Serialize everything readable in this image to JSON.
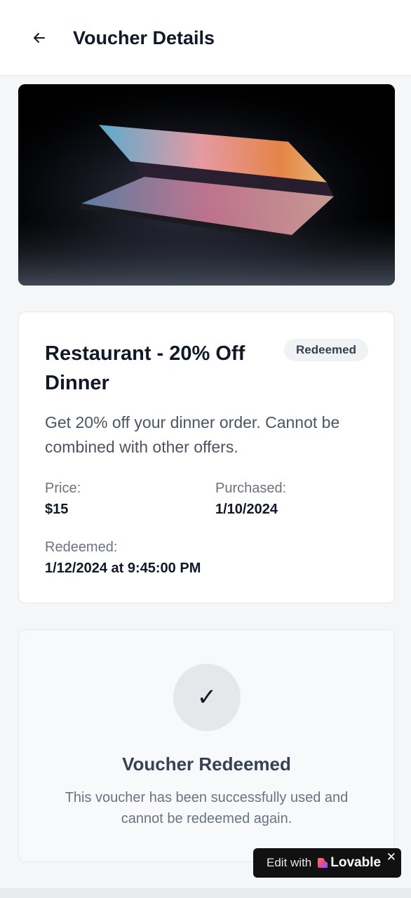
{
  "header": {
    "back_icon": "arrow-left-icon",
    "title": "Voucher Details"
  },
  "hero": {
    "image": "laptop-photo"
  },
  "voucher": {
    "title": "Restaurant - 20% Off Dinner",
    "status_badge": "Redeemed",
    "description": "Get 20% off your dinner order. Cannot be combined with other offers.",
    "price_label": "Price:",
    "price_value": "$15",
    "purchased_label": "Purchased:",
    "purchased_value": "1/10/2024",
    "redeemed_label": "Redeemed:",
    "redeemed_value": "1/12/2024 at 9:45:00 PM"
  },
  "status": {
    "icon": "checkmark-icon",
    "icon_glyph": "✓",
    "title": "Voucher Redeemed",
    "text": "This voucher has been successfully used and cannot be redeemed again."
  },
  "lovable": {
    "edit_label": "Edit with",
    "brand_label": "Lovable",
    "close_glyph": "✕"
  },
  "colors": {
    "page_bg": "#f5f6f8",
    "card_bg": "#ffffff",
    "badge_bg": "#f1f2f4",
    "badge_text": "#374151"
  }
}
